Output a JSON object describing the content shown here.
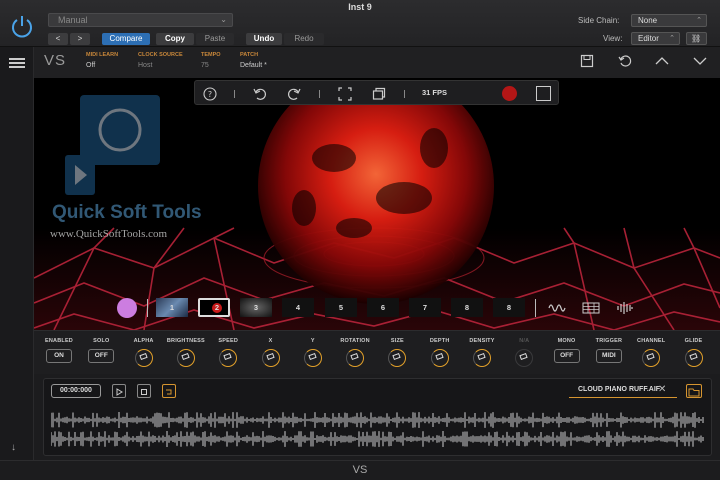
{
  "window": {
    "title": "Inst 9"
  },
  "host": {
    "preset_value": "Manual",
    "compare": "Compare",
    "copy": "Copy",
    "paste": "Paste",
    "undo": "Undo",
    "redo": "Redo",
    "side_chain_label": "Side Chain:",
    "side_chain_value": "None",
    "view_label": "View:",
    "view_value": "Editor"
  },
  "plugin": {
    "logo": "VS",
    "midi_learn_label": "MIDI LEARN",
    "midi_learn_value": "Off",
    "clock_label": "CLOCK SOURCE",
    "clock_value": "Host",
    "tempo_label": "TEMPO",
    "tempo_value": "75",
    "patch_label": "PATCH",
    "patch_value": "Default *",
    "accent": "#e3a12a"
  },
  "toolbar": {
    "fps": "31 FPS",
    "record_color": "#b31616"
  },
  "watermark": {
    "brand": "Quick Soft Tools",
    "url": "www.QuickSoftTools.com"
  },
  "patches": {
    "swatch_color": "#cc7de0",
    "slots": [
      "1",
      "2",
      "3",
      "4",
      "5",
      "6",
      "7",
      "8",
      "8"
    ],
    "selected": "2"
  },
  "controls": [
    {
      "label": "ENABLED",
      "kind": "toggle",
      "value": "ON"
    },
    {
      "label": "SOLO",
      "kind": "toggle",
      "value": "OFF"
    },
    {
      "label": "ALPHA",
      "kind": "knob"
    },
    {
      "label": "BRIGHTNESS",
      "kind": "knob"
    },
    {
      "label": "SPEED",
      "kind": "knob"
    },
    {
      "label": "X",
      "kind": "knob"
    },
    {
      "label": "Y",
      "kind": "knob"
    },
    {
      "label": "ROTATION",
      "kind": "knob"
    },
    {
      "label": "SIZE",
      "kind": "knob"
    },
    {
      "label": "DEPTH",
      "kind": "knob"
    },
    {
      "label": "DENSITY",
      "kind": "knob"
    },
    {
      "label": "N/A",
      "kind": "knob-disabled"
    },
    {
      "label": "MONO",
      "kind": "toggle",
      "value": "OFF"
    },
    {
      "label": "TRIGGER",
      "kind": "toggle",
      "value": "MIDI"
    },
    {
      "label": "CHANNEL",
      "kind": "knob"
    },
    {
      "label": "GLIDE",
      "kind": "knob"
    }
  ],
  "audio": {
    "time": "00:00:000",
    "file_name": "CLOUD PIANO RUFF.AIF"
  },
  "footer": {
    "logo": "VS"
  }
}
